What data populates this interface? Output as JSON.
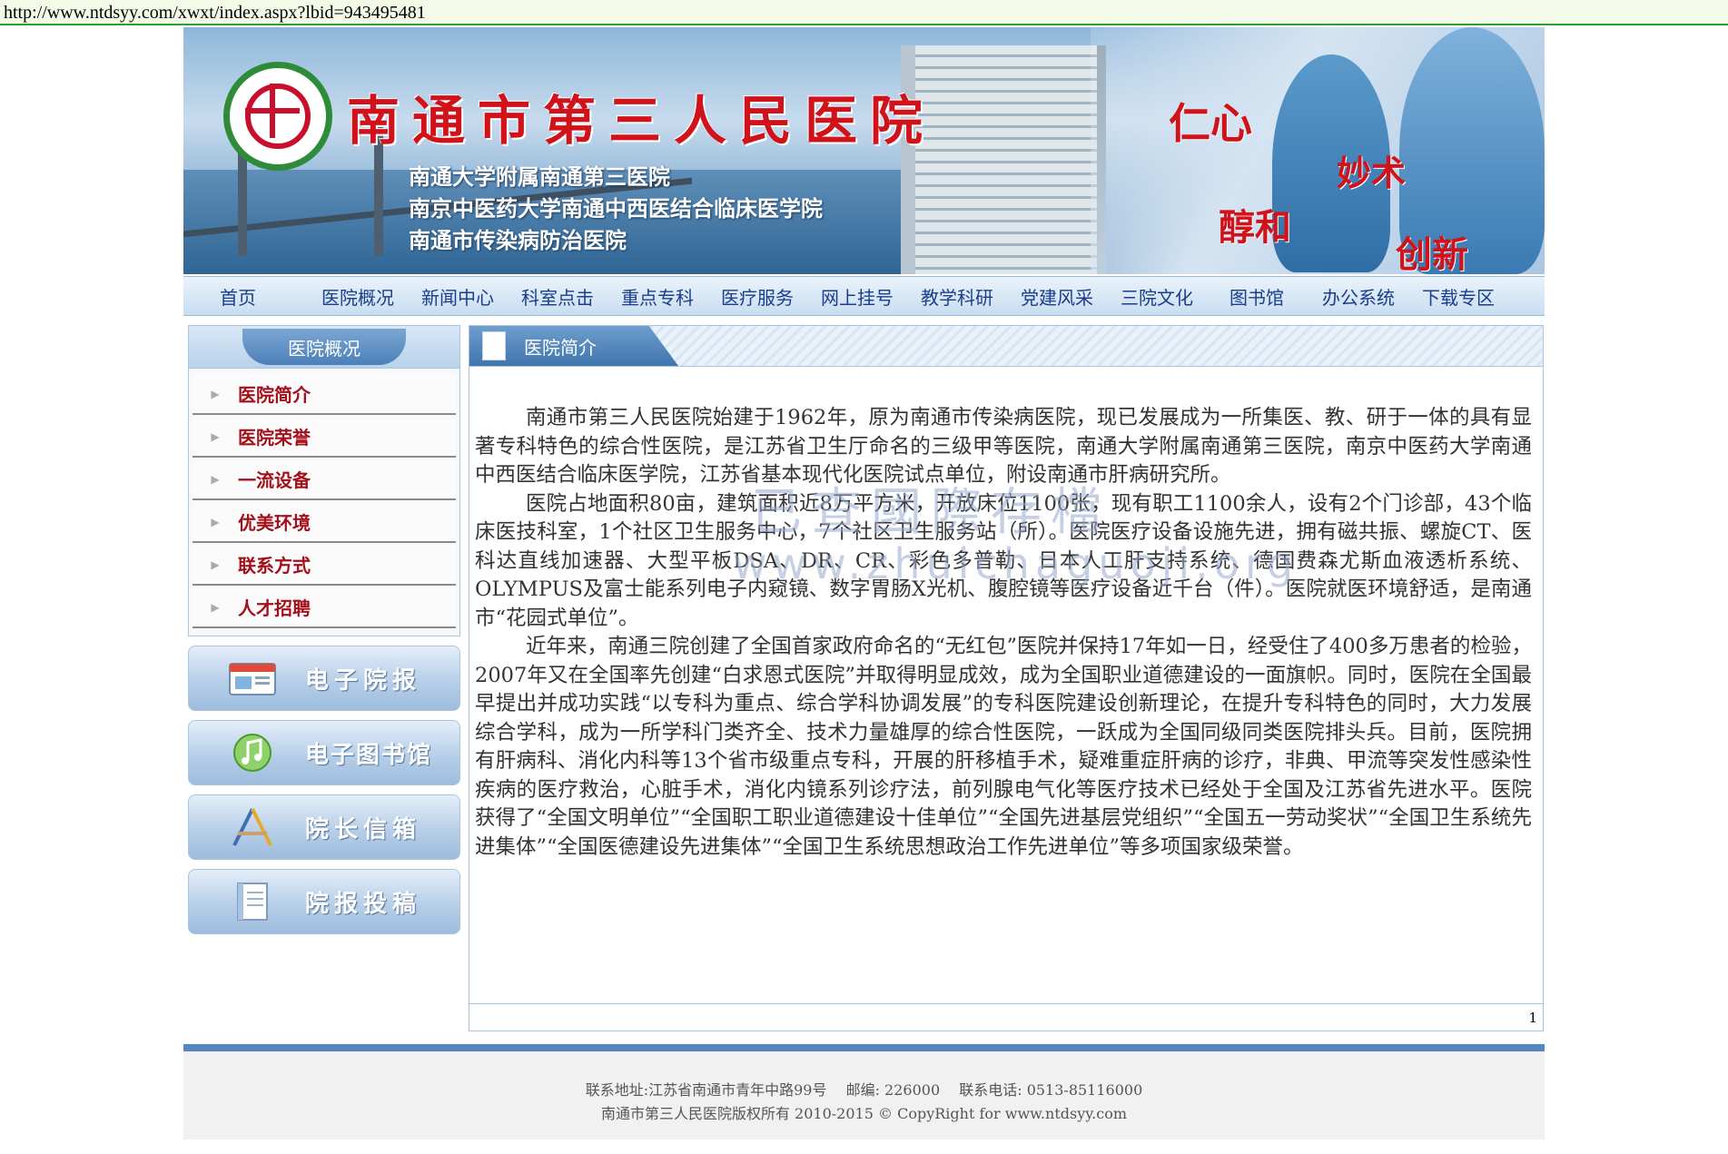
{
  "address_bar": {
    "url": "http://www.ntdsyy.com/xwxt/index.aspx?lbid=943495481"
  },
  "banner": {
    "title": "南通市第三人民医院",
    "subtitles": [
      "南通大学附属南通第三医院",
      "南京中医药大学南通中西医结合临床医学院",
      "南通市传染病防治医院"
    ],
    "motto": [
      "仁心",
      "妙术",
      "醇和",
      "创新"
    ]
  },
  "nav": {
    "items": [
      "首页",
      "医院概况",
      "新闻中心",
      "科室点击",
      "重点专科",
      "医疗服务",
      "网上挂号",
      "教学科研",
      "党建风采",
      "三院文化",
      "图书馆",
      "办公系统",
      "下载专区"
    ]
  },
  "sidebar": {
    "title": "医院概况",
    "items": [
      "医院简介",
      "医院荣誉",
      "一流设备",
      "优美环境",
      "联系方式",
      "人才招聘"
    ],
    "buttons": [
      "电子院报",
      "电子图书馆",
      "院长信箱",
      "院报投稿"
    ]
  },
  "main": {
    "title": "医院简介",
    "paragraphs": [
      "南通市第三人民医院始建于1962年，原为南通市传染病医院，现已发展成为一所集医、教、研于一体的具有显著专科特色的综合性医院，是江苏省卫生厅命名的三级甲等医院，南通大学附属南通第三医院，南京中医药大学南通中西医结合临床医学院，江苏省基本现代化医院试点单位，附设南通市肝病研究所。",
      "医院占地面积80亩，建筑面积近8万平方米，开放床位1100张，现有职工1100余人，设有2个门诊部，43个临床医技科室，1个社区卫生服务中心，7个社区卫生服务站（所）。医院医疗设备设施先进，拥有磁共振、螺旋CT、医科达直线加速器、大型平板DSA、DR、CR、彩色多普勒、日本人工肝支持系统、德国费森尤斯血液透析系统、OLYMPUS及富士能系列电子内窥镜、数字胃肠X光机、腹腔镜等医疗设备近千台（件）。医院就医环境舒适，是南通市“花园式单位”。",
      "近年来，南通三院创建了全国首家政府命名的“无红包”医院并保持17年如一日，经受住了400多万患者的检验，2007年又在全国率先创建“白求恩式医院”并取得明显成效，成为全国职业道德建设的一面旗帜。同时，医院在全国最早提出并成功实践“以专科为重点、综合学科协调发展”的专科医院建设创新理论，在提升专科特色的同时，大力发展综合学科，成为一所学科门类齐全、技术力量雄厚的综合性医院，一跃成为全国同级同类医院排头兵。目前，医院拥有肝病科、消化内科等13个省市级重点专科，开展的肝移植手术，疑难重症肝病的诊疗，非典、甲流等突发性感染性疾病的医疗救治，心脏手术，消化内镜系列诊疗法，前列腺电气化等医疗技术已经处于全国及江苏省先进水平。医院获得了“全国文明单位”“全国职工职业道德建设十佳单位”“全国先进基层党组织”“全国五一劳动奖状”“全国卫生系统先进集体”“全国医德建设先进集体”“全国卫生系统思想政治工作先进单位”等多项国家级荣誉。"
    ],
    "page_number": "1"
  },
  "watermark": {
    "text": "已查國際存檔",
    "url": "www.zhuichaguoji.org"
  },
  "footer": {
    "line1": "联系地址:江苏省南通市青年中路99号　 邮编: 226000　 联系电话: 0513-85116000",
    "line2": "南通市第三人民医院版权所有 2010-2015 © CopyRight for www.ntdsyy.com"
  }
}
